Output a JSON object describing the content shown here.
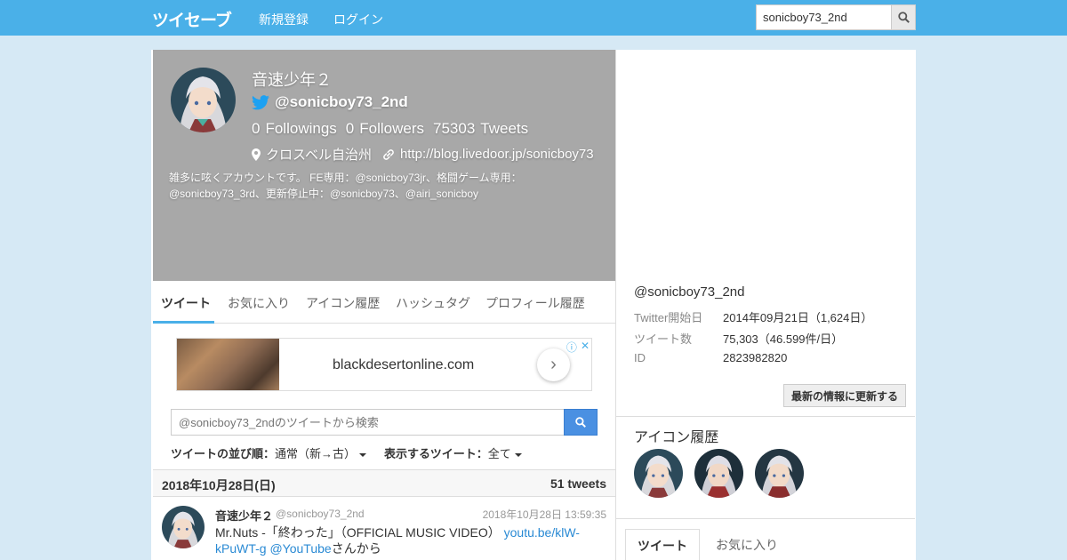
{
  "header": {
    "logo": "ツイセーブ",
    "nav": [
      "新規登録",
      "ログイン"
    ],
    "search_value": "sonicboy73_2nd"
  },
  "profile": {
    "name": "音速少年２",
    "handle": "@sonicboy73_2nd",
    "followings_count": "0",
    "followings_label": "Followings",
    "followers_count": "0",
    "followers_label": "Followers",
    "tweets_count": "75303",
    "tweets_label": "Tweets",
    "location": "クロスベル自治州",
    "url": "http://blog.livedoor.jp/sonicboy73",
    "bio": "雑多に呟くアカウントです。 FE専用：@sonicboy73jr、格闘ゲーム専用：@sonicboy73_3rd、更新停止中：@sonicboy73、@airi_sonicboy"
  },
  "tabs": [
    "ツイート",
    "お気に入り",
    "アイコン履歴",
    "ハッシュタグ",
    "プロフィール履歴"
  ],
  "ad": {
    "text": "blackdesertonline.com"
  },
  "tweet_search": {
    "placeholder": "@sonicboy73_2ndのツイートから検索"
  },
  "sort": {
    "order_label": "ツイートの並び順：",
    "order_value": "通常（新→古）",
    "show_label": "表示するツイート：",
    "show_value": "全て"
  },
  "date_group": {
    "date": "2018年10月28日(日)",
    "count": "51 tweets"
  },
  "tweet": {
    "name": "音速少年２",
    "handle": "@sonicboy73_2nd",
    "time": "2018年10月28日 13:59:35",
    "text_prefix": "Mr.Nuts -「終わった」（OFFICIAL MUSIC VIDEO） ",
    "link1": "youtu.be/klW-kPuWT-g",
    "link2": "@YouTube",
    "text_suffix": "さんから"
  },
  "side": {
    "handle": "@sonicboy73_2nd",
    "rows": [
      {
        "k": "Twitter開始日",
        "v": "2014年09月21日（1,624日）"
      },
      {
        "k": "ツイート数",
        "v": "75,303（46.599件/日）"
      },
      {
        "k": "ID",
        "v": "2823982820"
      }
    ],
    "refresh_label": "最新の情報に更新する",
    "icon_history_title": "アイコン履歴",
    "tabs": [
      "ツイート",
      "お気に入り"
    ]
  },
  "colors": {
    "brand": "#4ab0e8",
    "link": "#2a8ad4",
    "header_bg": "#a8a8a8"
  }
}
